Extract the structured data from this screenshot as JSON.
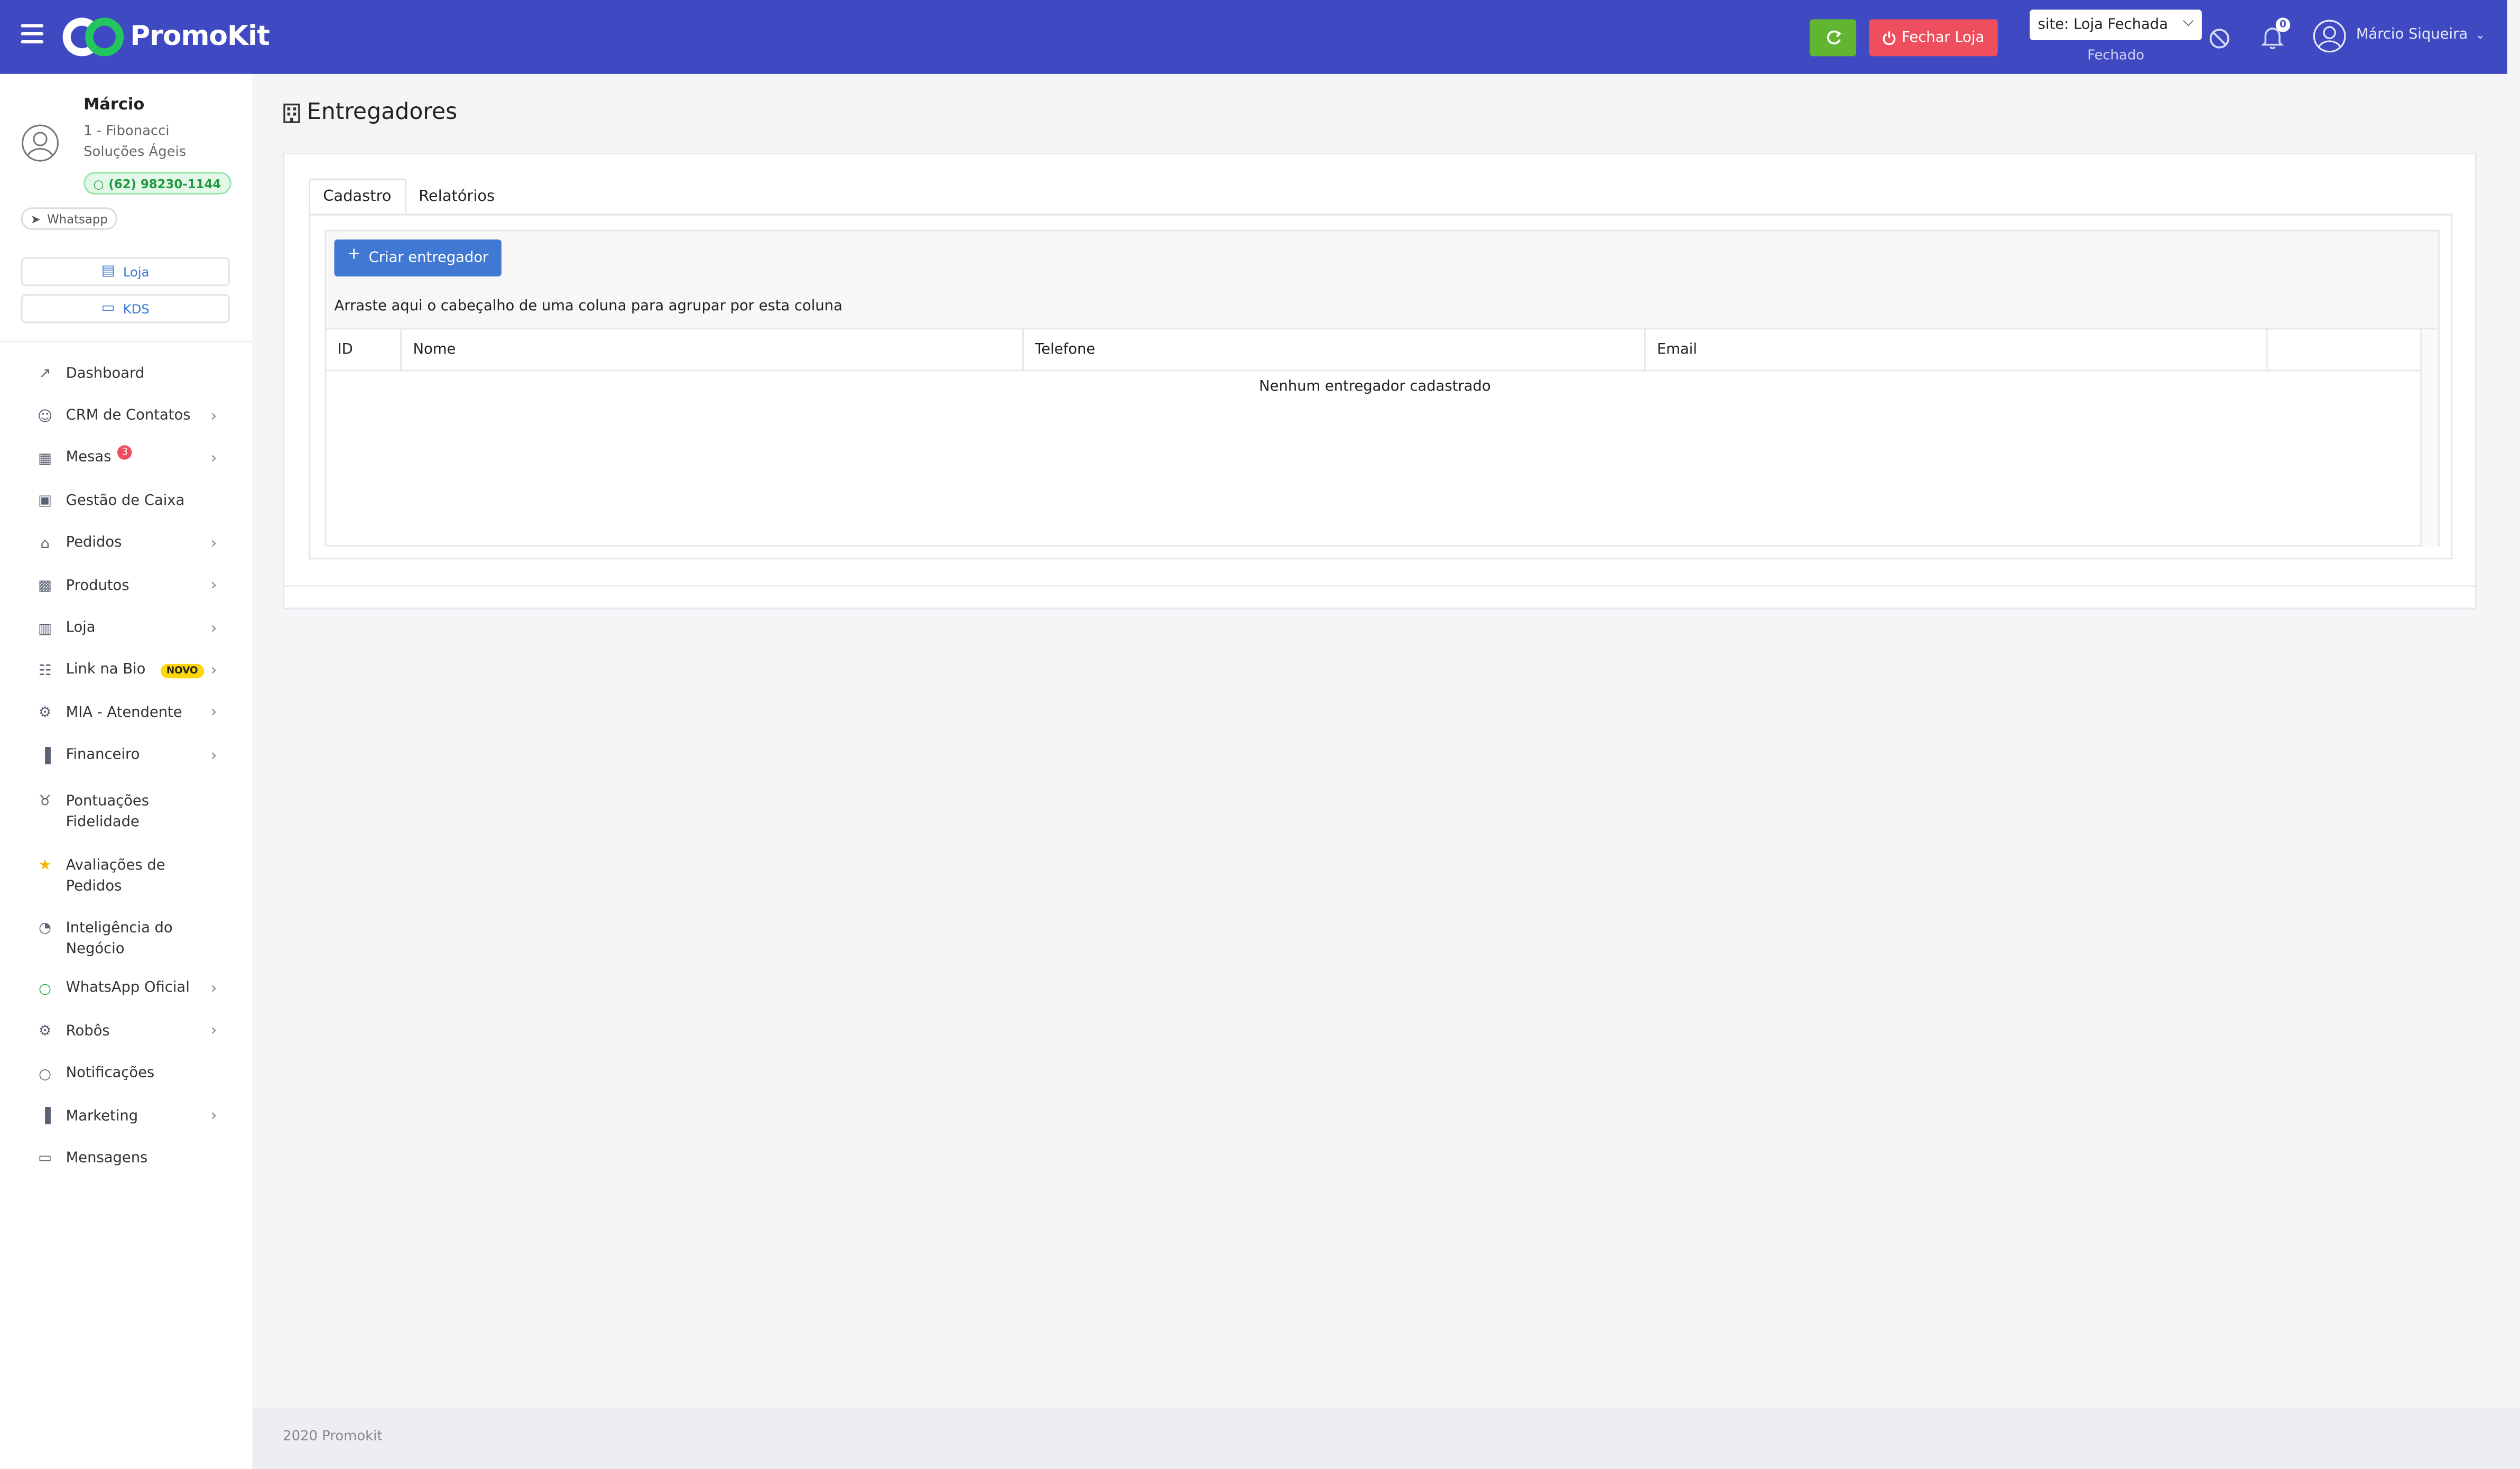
{
  "header": {
    "brand": "PromoKit",
    "close_store_label": "Fechar Loja",
    "site_select_value": "site: Loja Fechada",
    "site_status": "Fechado",
    "notification_count": "0",
    "user_name": "Márcio Siqueira",
    "accent_color": "#3f4ac2"
  },
  "profile": {
    "name": "Márcio",
    "company_line1": "1 - Fibonacci",
    "company_line2": "Soluções Ágeis",
    "phone": "(62) 98230-1144",
    "whatsapp_label": "Whatsapp",
    "store_button": "Loja",
    "kds_button": "KDS"
  },
  "menu": [
    {
      "label": "Dashboard",
      "icon": "chart-line-icon",
      "arrow": false
    },
    {
      "label": "CRM de Contatos",
      "icon": "users-icon",
      "arrow": true
    },
    {
      "label": "Mesas",
      "icon": "table-icon",
      "arrow": true,
      "badge": "3"
    },
    {
      "label": "Gestão de Caixa",
      "icon": "cash-register-icon",
      "arrow": false
    },
    {
      "label": "Pedidos",
      "icon": "cart-icon",
      "arrow": true
    },
    {
      "label": "Produtos",
      "icon": "boxes-icon",
      "arrow": true
    },
    {
      "label": "Loja",
      "icon": "building-icon",
      "arrow": true
    },
    {
      "label": "Link na Bio",
      "icon": "sitemap-icon",
      "arrow": true,
      "tag": "NOVO"
    },
    {
      "label": "MIA - Atendente",
      "icon": "robot-icon",
      "arrow": true
    },
    {
      "label": "Financeiro",
      "icon": "bar-chart-icon",
      "arrow": true
    },
    {
      "label": "Pontuações Fidelidade",
      "icon": "medal-icon",
      "arrow": false
    },
    {
      "label": "Avaliações de Pedidos",
      "icon": "star-icon",
      "arrow": false
    },
    {
      "label": "Inteligência do Negócio",
      "icon": "pie-chart-icon",
      "arrow": false
    },
    {
      "label": "WhatsApp Oficial",
      "icon": "whatsapp-icon",
      "arrow": true
    },
    {
      "label": "Robôs",
      "icon": "robot-icon",
      "arrow": true
    },
    {
      "label": "Notificações",
      "icon": "whatsapp-icon",
      "arrow": false
    },
    {
      "label": "Marketing",
      "icon": "bar-chart-icon",
      "arrow": true
    },
    {
      "label": "Mensagens",
      "icon": "inbox-icon",
      "arrow": false
    }
  ],
  "page": {
    "title": "Entregadores",
    "tabs": [
      "Cadastro",
      "Relatórios"
    ],
    "create_button": "Criar entregador",
    "group_hint": "Arraste aqui o cabeçalho de uma coluna para agrupar por esta coluna",
    "columns": [
      "ID",
      "Nome",
      "Telefone",
      "Email"
    ],
    "empty_message": "Nenhum entregador cadastrado"
  },
  "footer": {
    "text": "2020 Promokit"
  }
}
